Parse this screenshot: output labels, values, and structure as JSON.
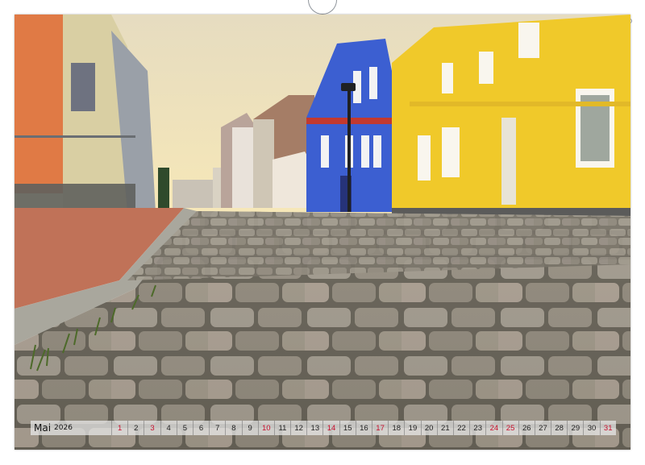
{
  "calendar": {
    "month": "Mai",
    "year": "2026",
    "days": [
      "1",
      "2",
      "3",
      "4",
      "5",
      "6",
      "7",
      "8",
      "9",
      "10",
      "11",
      "12",
      "13",
      "14",
      "15",
      "16",
      "17",
      "18",
      "19",
      "20",
      "21",
      "22",
      "23",
      "24",
      "25",
      "26",
      "27",
      "28",
      "29",
      "30",
      "31"
    ],
    "sunday_days": [
      "3",
      "10",
      "17",
      "24",
      "31"
    ],
    "holiday_days": [
      "1",
      "14",
      "25"
    ],
    "sunday_color": "#c8102e"
  },
  "photo": {
    "subject": "cobblestone-street-with-colorful-houses",
    "colors": {
      "sky": "#f2e7c4",
      "yellow_house": "#f0c92a",
      "blue_house": "#3c5fd1",
      "orange_house": "#e07a45",
      "cobblestone": "#8a8376"
    }
  }
}
